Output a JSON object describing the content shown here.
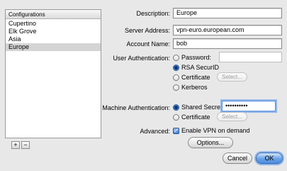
{
  "configurations": {
    "header": "Configurations",
    "items": [
      "Cupertino",
      "Elk Grove",
      "Asia",
      "Europe"
    ],
    "selected": "Europe",
    "add_label": "+",
    "remove_label": "−"
  },
  "form": {
    "description_label": "Description:",
    "description_value": "Europe",
    "server_label": "Server Address:",
    "server_value": "vpn-euro.european.com",
    "account_label": "Account Name:",
    "account_value": "bob",
    "user_auth_label": "User Authentication:",
    "user_auth_options": {
      "password": "Password:",
      "rsa": "RSA SecurID",
      "certificate": "Certificate",
      "kerberos": "Kerberos"
    },
    "user_auth_selected": "RSA SecurID",
    "select_label": "Select...",
    "machine_auth_label": "Machine Authentication:",
    "machine_auth_options": {
      "shared_secret": "Shared Secret:",
      "certificate": "Certificate"
    },
    "machine_auth_selected": "Shared Secret:",
    "shared_secret_value": "••••••••••",
    "advanced_label": "Advanced:",
    "enable_vpn_label": "Enable VPN on demand",
    "enable_vpn_checked": true,
    "options_button": "Options..."
  },
  "footer": {
    "cancel_label": "Cancel",
    "ok_label": "OK"
  }
}
